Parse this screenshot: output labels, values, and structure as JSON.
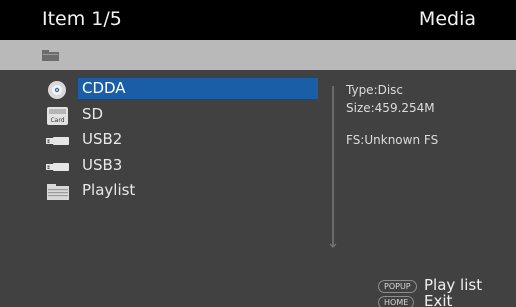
{
  "header": {
    "item_counter": "Item 1/5",
    "title": "Media"
  },
  "pathbar": {
    "icon": "folder-icon"
  },
  "devices": [
    {
      "label": "CDDA",
      "icon": "disc-icon",
      "selected": true
    },
    {
      "label": "SD",
      "icon": "sd-card-icon",
      "card_text": "Card"
    },
    {
      "label": "USB2",
      "icon": "usb-icon"
    },
    {
      "label": "USB3",
      "icon": "usb-icon"
    },
    {
      "label": "Playlist",
      "icon": "playlist-folder-icon"
    }
  ],
  "info": {
    "type": "Type:Disc",
    "size": "Size:459.254M",
    "fs": "FS:Unknown FS"
  },
  "hints": [
    {
      "key": "POPUP",
      "action": "Play list"
    },
    {
      "key": "HOME",
      "action": "Exit"
    }
  ],
  "colors": {
    "selection": "#1b5ea8",
    "background": "#414141",
    "header": "#000000",
    "pathbar": "#b9b9b9"
  }
}
